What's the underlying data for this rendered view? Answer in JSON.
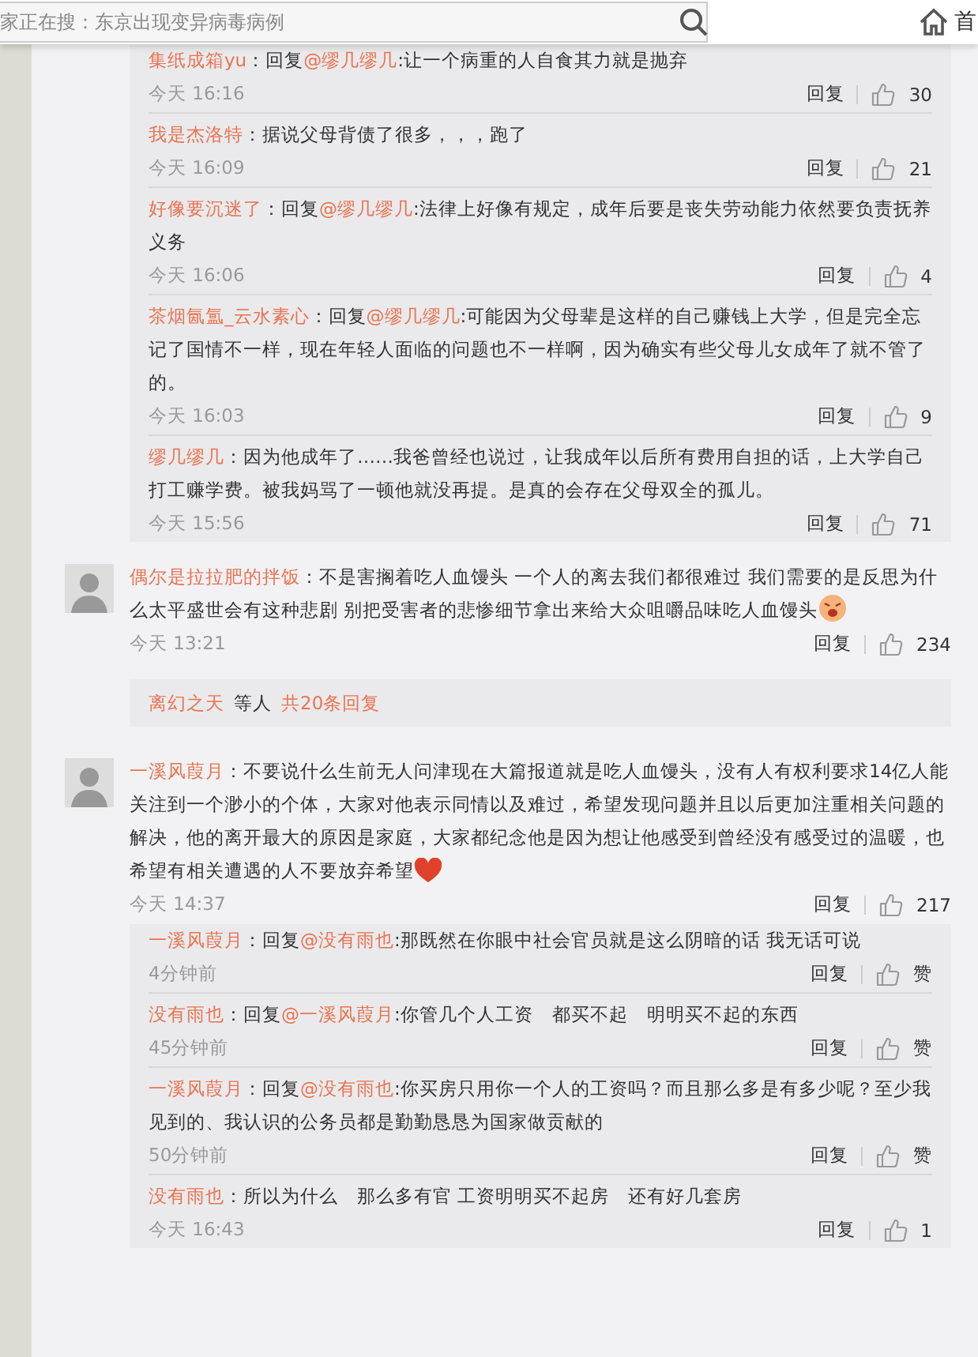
{
  "header": {
    "search": {
      "placeholder": "家正在搜：东京出现变异病毒病例"
    },
    "home_label": "首"
  },
  "feed": [
    {
      "kind": "replies",
      "replies": [
        {
          "user": "集纸成箱yu",
          "body": [
            {
              "kind": "plain",
              "text": "：回复"
            },
            {
              "kind": "mention",
              "text": "@缪几缪几"
            },
            {
              "kind": "plain",
              "text": ":让一个病重的人自食其力就是抛弃"
            }
          ],
          "time": "今天 16:16",
          "reply_label": "回复",
          "likes": "30"
        },
        {
          "user": "我是杰洛特",
          "body": [
            {
              "kind": "plain",
              "text": "：据说父母背债了很多，，，跑了"
            }
          ],
          "time": "今天 16:09",
          "reply_label": "回复",
          "likes": "21"
        },
        {
          "user": "好像要沉迷了",
          "body": [
            {
              "kind": "plain",
              "text": "：回复"
            },
            {
              "kind": "mention",
              "text": "@缪几缪几"
            },
            {
              "kind": "plain",
              "text": ":法律上好像有规定，成年后要是丧失劳动能力依然要负责抚养义务"
            }
          ],
          "time": "今天 16:06",
          "reply_label": "回复",
          "likes": "4"
        },
        {
          "user": "茶烟氤氲_云水素心",
          "body": [
            {
              "kind": "plain",
              "text": "：回复"
            },
            {
              "kind": "mention",
              "text": "@缪几缪几"
            },
            {
              "kind": "plain",
              "text": ":可能因为父母辈是这样的自己赚钱上大学，但是完全忘记了国情不一样，现在年轻人面临的问题也不一样啊，因为确实有些父母儿女成年了就不管了的。"
            }
          ],
          "time": "今天 16:03",
          "reply_label": "回复",
          "likes": "9"
        },
        {
          "user": "缪几缪几",
          "body": [
            {
              "kind": "plain",
              "text": "：因为他成年了……我爸曾经也说过，让我成年以后所有费用自担的话，上大学自己打工赚学费。被我妈骂了一顿他就没再提。是真的会存在父母双全的孤儿。"
            }
          ],
          "time": "今天 15:56",
          "reply_label": "回复",
          "likes": "71"
        }
      ]
    },
    {
      "kind": "comment",
      "user": "偶尔是拉拉肥的拌饭",
      "body": [
        {
          "kind": "plain",
          "text": "：不是害搁着吃人血馒头 一个人的离去我们都很难过 我们需要的是反思为什么太平盛世会有这种悲剧 别把受害者的悲惨细节拿出来给大众咀嚼品味吃人血馒头"
        },
        {
          "kind": "angry_face"
        }
      ],
      "time": "今天 13:21",
      "reply_label": "回复",
      "likes": "234"
    },
    {
      "kind": "more",
      "segments": [
        {
          "kind": "mention",
          "text": "离幻之天"
        },
        {
          "kind": "plain",
          "text": "等人"
        },
        {
          "kind": "mention",
          "text": "共20条回复"
        }
      ]
    },
    {
      "kind": "comment",
      "user": "一溪风葭月",
      "body": [
        {
          "kind": "plain",
          "text": "：不要说什么生前无人问津现在大篇报道就是吃人血馒头，没有人有权利要求14亿人能关注到一个渺小的个体，大家对他表示同情以及难过，希望发现问题并且以后更加注重相关问题的解决，他的离开最大的原因是家庭，大家都纪念他是因为想让他感受到曾经没有感受过的温暖，也希望有相关遭遇的人不要放弃希望"
        },
        {
          "kind": "heart"
        }
      ],
      "time": "今天 14:37",
      "reply_label": "回复",
      "likes": "217"
    },
    {
      "kind": "replies",
      "replies": [
        {
          "user": "一溪风葭月",
          "body": [
            {
              "kind": "plain",
              "text": "：回复"
            },
            {
              "kind": "mention",
              "text": "@没有雨也"
            },
            {
              "kind": "plain",
              "text": ":那既然在你眼中社会官员就是这么阴暗的话 我无话可说"
            }
          ],
          "time": "4分钟前",
          "reply_label": "回复",
          "likes": "赞"
        },
        {
          "user": "没有雨也",
          "body": [
            {
              "kind": "plain",
              "text": "：回复"
            },
            {
              "kind": "mention",
              "text": "@一溪风葭月"
            },
            {
              "kind": "plain",
              "text": ":你管几个人工资　都买不起　明明买不起的东西"
            }
          ],
          "time": "45分钟前",
          "reply_label": "回复",
          "likes": "赞"
        },
        {
          "user": "一溪风葭月",
          "body": [
            {
              "kind": "plain",
              "text": "：回复"
            },
            {
              "kind": "mention",
              "text": "@没有雨也"
            },
            {
              "kind": "plain",
              "text": ":你买房只用你一个人的工资吗？而且那么多是有多少呢？至少我见到的、我认识的公务员都是勤勤恳恳为国家做贡献的"
            }
          ],
          "time": "50分钟前",
          "reply_label": "回复",
          "likes": "赞"
        },
        {
          "user": "没有雨也",
          "body": [
            {
              "kind": "plain",
              "text": "：所以为什么　那么多有官 工资明明买不起房　还有好几套房"
            }
          ],
          "time": "今天 16:43",
          "reply_label": "回复",
          "likes": "1"
        }
      ]
    }
  ]
}
